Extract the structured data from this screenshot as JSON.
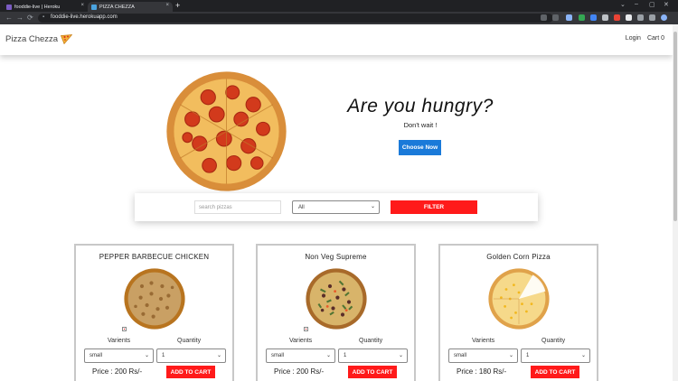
{
  "browser": {
    "tabs": [
      {
        "title": "fooddie-live | Heroku",
        "active": false
      },
      {
        "title": "PIZZA CHEZZA",
        "active": true
      }
    ],
    "url": "fooddie-live.herokuapp.com",
    "icons": {
      "back": "←",
      "forward": "→",
      "reload": "⟳",
      "close": "×",
      "new_tab": "+",
      "lock": "🔒"
    }
  },
  "navbar": {
    "brand": "Pizza Chezza",
    "links": [
      "Login",
      "Cart 0"
    ]
  },
  "hero": {
    "title": "Are you hungry?",
    "subtitle": "Don't wait !",
    "cta": "Choose Now"
  },
  "filter": {
    "search_placeholder": "search pizzas",
    "category_selected": "All",
    "button": "FILTER"
  },
  "pizzas": [
    {
      "name": "PEPPER BARBECUE CHICKEN",
      "variants_label": "Varients",
      "quantity_label": "Quantity",
      "size": "small",
      "qty": "1",
      "price": "Price : 200 Rs/-",
      "button": "ADD TO CART"
    },
    {
      "name": "Non Veg Supreme",
      "variants_label": "Varients",
      "quantity_label": "Quantity",
      "size": "small",
      "qty": "1",
      "price": "Price : 200 Rs/-",
      "button": "ADD TO CART"
    },
    {
      "name": "Golden Corn Pizza",
      "variants_label": "Varients",
      "quantity_label": "Quantity",
      "size": "small",
      "qty": "1",
      "price": "Price : 180 Rs/-",
      "button": "ADD TO CART"
    }
  ],
  "colors": {
    "accent_red": "#ff1a1a",
    "accent_blue": "#1a7ad9"
  }
}
